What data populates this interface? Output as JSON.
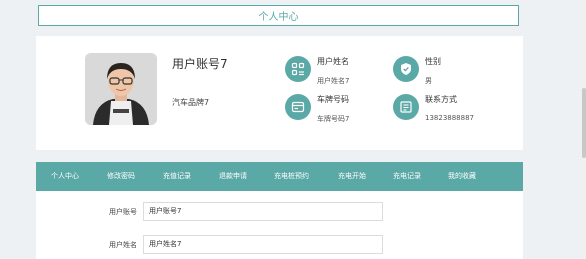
{
  "header": {
    "title": "个人中心"
  },
  "profile": {
    "username": "用户账号7",
    "brand": "汽车品牌7",
    "fields": [
      {
        "label": "用户姓名",
        "value": "用户姓名7",
        "icon": "user-card-icon"
      },
      {
        "label": "性别",
        "value": "男",
        "icon": "shield-icon"
      },
      {
        "label": "车牌号码",
        "value": "车牌号码7",
        "icon": "card-icon"
      },
      {
        "label": "联系方式",
        "value": "13823888887",
        "icon": "contact-icon"
      }
    ]
  },
  "nav": {
    "items": [
      "个人中心",
      "修改密码",
      "充值记录",
      "退款申请",
      "充电桩预约",
      "充电开始",
      "充电记录",
      "我的收藏"
    ]
  },
  "form": {
    "fields": [
      {
        "label": "用户账号",
        "value": "用户账号7"
      },
      {
        "label": "用户姓名",
        "value": "用户姓名7"
      }
    ]
  },
  "colors": {
    "accent": "#5aa9a6"
  }
}
